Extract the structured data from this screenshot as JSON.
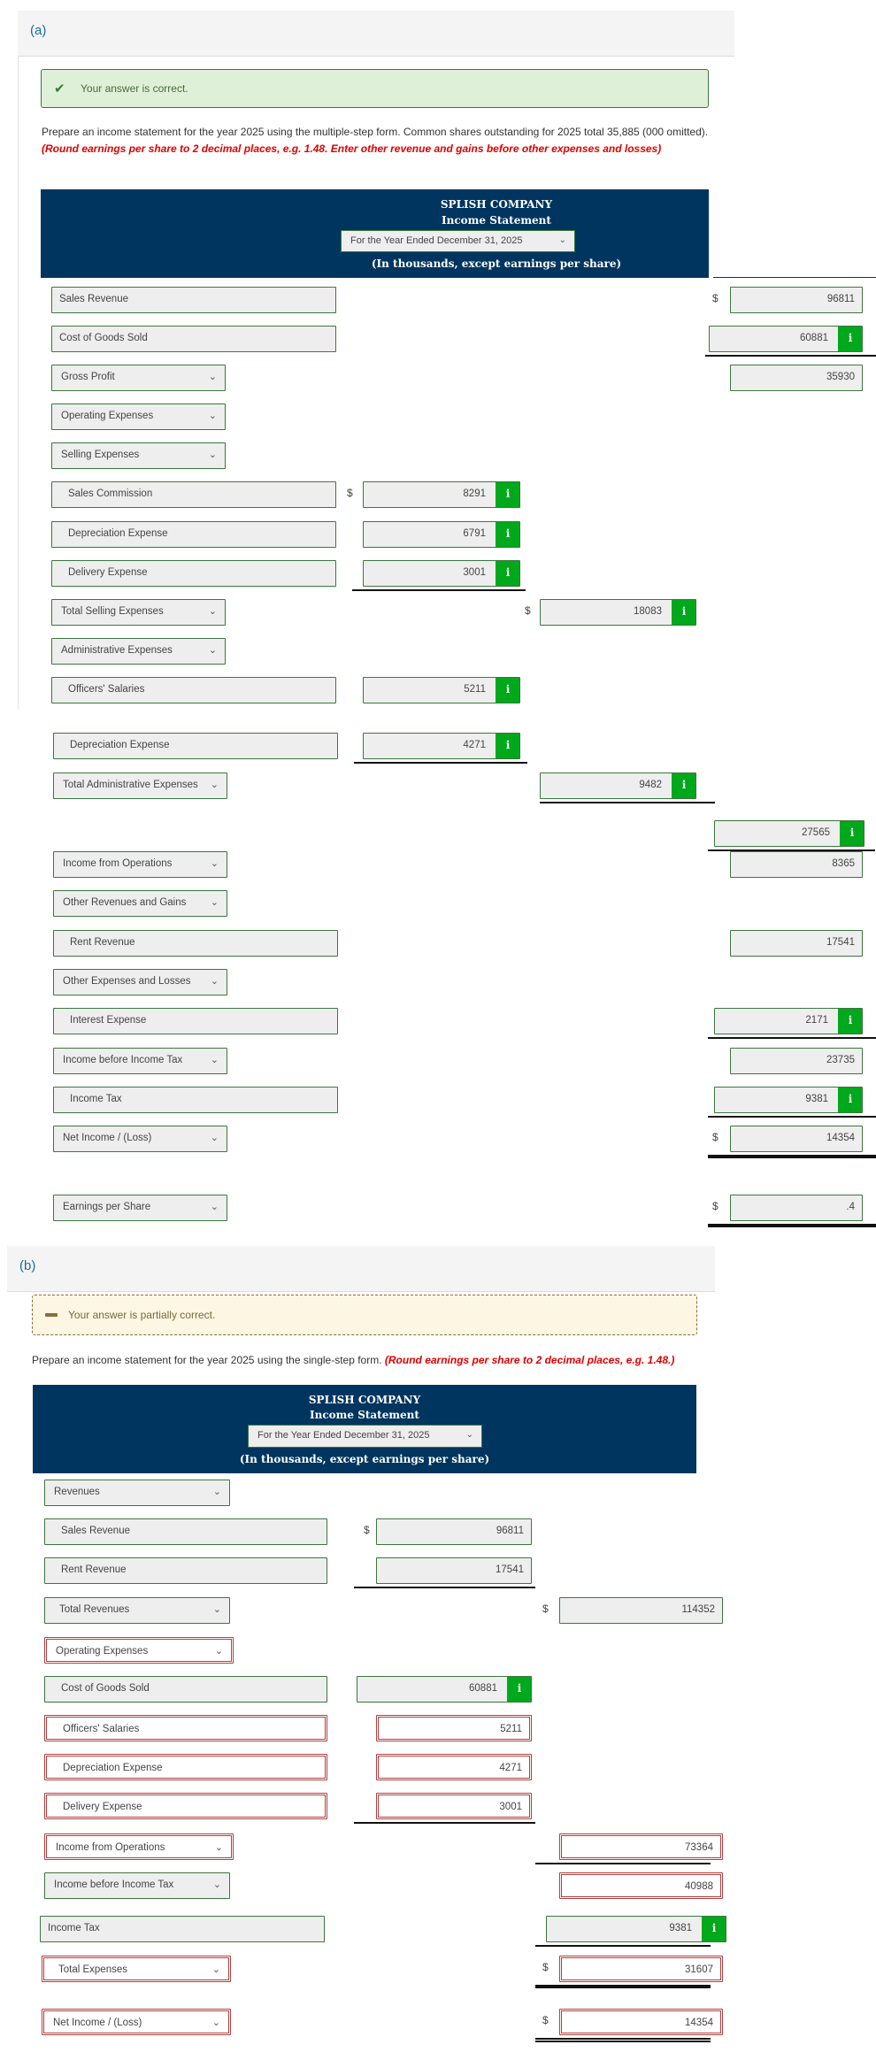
{
  "part_a": {
    "label": "(a)",
    "feedback": {
      "icon": "check-icon",
      "text": "Your answer is correct.",
      "status": "correct",
      "color": "#3c763d"
    },
    "instructions": "Prepare an income statement for the year 2025 using the multiple-step form. Common shares outstanding for 2025 total 35,885 (000 omitted). ",
    "instructions_red": "(Round earnings per share to 2 decimal places, e.g. 1.48. Enter other revenue and gains before other expenses and losses)",
    "header": {
      "company": "SPLISH COMPANY",
      "statement": "Income Statement",
      "period": "For the Year Ended December 31, 2025",
      "units": "(In thousands, except earnings per share)"
    },
    "rows": [
      {
        "label": "Sales Revenue",
        "type": "text",
        "col3": "96811",
        "dollar3": "$"
      },
      {
        "label": "Cost of Goods Sold",
        "type": "text",
        "col3": "60881",
        "info3": "i"
      },
      {
        "label": "Gross Profit",
        "type": "select",
        "col3": "35930"
      },
      {
        "label": "Operating Expenses",
        "type": "select"
      },
      {
        "label": "Selling Expenses",
        "type": "select"
      },
      {
        "label": "Sales Commission",
        "type": "text",
        "col1": "8291",
        "dollar1": "$",
        "info1": "i"
      },
      {
        "label": "Depreciation Expense",
        "type": "text",
        "col1": "6791",
        "info1": "i"
      },
      {
        "label": "Delivery Expense",
        "type": "text",
        "col1": "3001",
        "info1": "i"
      },
      {
        "label": "Total Selling Expenses",
        "type": "select",
        "col2": "18083",
        "dollar2": "$",
        "info2": "i"
      },
      {
        "label": "Administrative Expenses",
        "type": "select"
      },
      {
        "label": "Officers' Salaries",
        "type": "text",
        "col1": "5211",
        "info1": "i"
      },
      {
        "label": "Depreciation Expense",
        "type": "text",
        "col1": "4271",
        "info1": "i"
      },
      {
        "label": "Total Administrative Expenses",
        "type": "select",
        "col2": "9482",
        "info2": "i"
      },
      {
        "label": "",
        "type": "none",
        "col3": "27565",
        "info3": "i"
      },
      {
        "label": "Income from Operations",
        "type": "select",
        "col3": "8365"
      },
      {
        "label": "Other Revenues and Gains",
        "type": "select"
      },
      {
        "label": "Rent Revenue",
        "type": "text",
        "col3": "17541"
      },
      {
        "label": "Other Expenses and Losses",
        "type": "select"
      },
      {
        "label": "Interest Expense",
        "type": "text",
        "col3": "2171",
        "info3": "i"
      },
      {
        "label": "Income before Income Tax",
        "type": "select",
        "col3": "23735"
      },
      {
        "label": "Income Tax",
        "type": "text",
        "col3": "9381",
        "info3": "i"
      },
      {
        "label": "Net Income / (Loss)",
        "type": "select",
        "col3": "14354",
        "dollar3": "$"
      },
      {
        "label": "Earnings per Share",
        "type": "select",
        "col3": ".4",
        "dollar3": "$"
      }
    ]
  },
  "part_b": {
    "label": "(b)",
    "feedback": {
      "icon": "dash-icon",
      "text": "Your answer is partially correct.",
      "status": "partial",
      "color": "#8a6d3b"
    },
    "instructions": "Prepare an income statement for the year 2025 using the single-step form. ",
    "instructions_red": "(Round earnings per share to 2 decimal places, e.g. 1.48.)",
    "header": {
      "company": "SPLISH COMPANY",
      "statement": "Income Statement",
      "period": "For the Year Ended December 31, 2025",
      "units": "(In thousands, except earnings per share)"
    },
    "rows": [
      {
        "label": "Revenues",
        "type": "select"
      },
      {
        "label": "Sales Revenue",
        "type": "text",
        "col1": "96811",
        "dollar1": "$"
      },
      {
        "label": "Rent Revenue",
        "type": "text",
        "col1": "17541"
      },
      {
        "label": "Total Revenues",
        "type": "select",
        "col2": "114352",
        "dollar2": "$"
      },
      {
        "label": "Operating Expenses",
        "type": "select",
        "wrong": true
      },
      {
        "label": "Cost of Goods Sold",
        "type": "text",
        "col1": "60881",
        "info1": "i"
      },
      {
        "label": "Officers' Salaries",
        "type": "text",
        "col1": "5211",
        "wrong": true
      },
      {
        "label": "Depreciation Expense",
        "type": "text",
        "col1": "4271",
        "wrong": true
      },
      {
        "label": "Delivery Expense",
        "type": "text",
        "col1": "3001",
        "wrong": true
      },
      {
        "label": "Income from Operations",
        "type": "select",
        "col2": "73364",
        "wrong": true
      },
      {
        "label": "Income before Income Tax",
        "type": "select",
        "col2": "40988",
        "wrong_value": true
      },
      {
        "label": "Income Tax",
        "type": "text",
        "col2": "9381",
        "info2": "i"
      },
      {
        "label": "Total Expenses",
        "type": "select",
        "col2": "31607",
        "dollar2": "$",
        "wrong": true
      },
      {
        "label": "Net Income / (Loss)",
        "type": "select",
        "col2": "14354",
        "dollar2": "$",
        "wrong": true
      }
    ]
  },
  "colors": {
    "header_bg": "#00355f",
    "correct_border": "#3c763d",
    "wrong_border": "#b04040",
    "info_badge": "#00a81c",
    "red_text": "#e00000",
    "section_label": "#1a6aa6"
  }
}
